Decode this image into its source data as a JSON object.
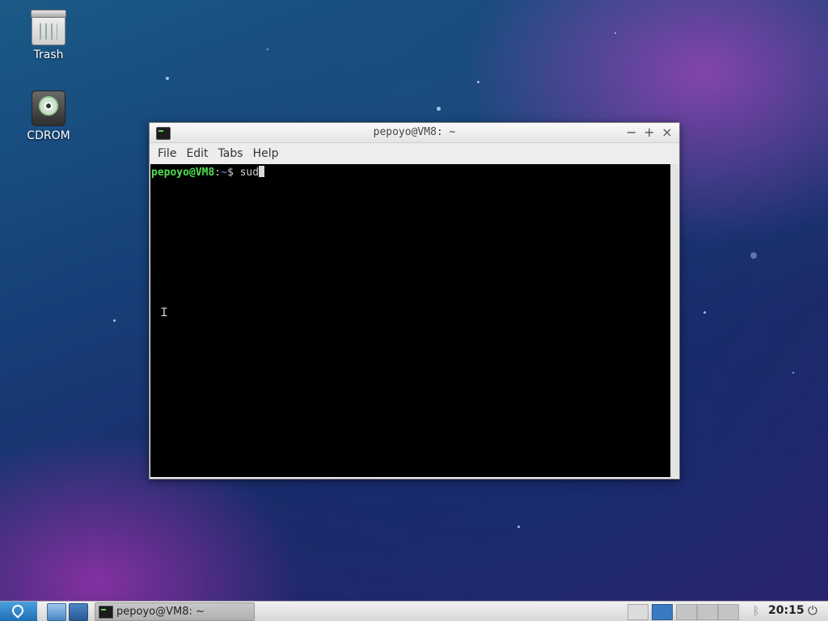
{
  "desktop": {
    "icons": [
      {
        "label": "Trash"
      },
      {
        "label": "CDROM"
      }
    ]
  },
  "window": {
    "title": "pepoyo@VM8: ~",
    "controls": {
      "minimize": "−",
      "maximize": "+",
      "close": "×"
    },
    "menu": [
      "File",
      "Edit",
      "Tabs",
      "Help"
    ],
    "terminal": {
      "user_host": "pepoyo@VM8",
      "colon": ":",
      "path": "~",
      "symbol": "$",
      "command": "sud"
    }
  },
  "taskbar": {
    "task_label": "pepoyo@VM8: ~",
    "clock": "20:15",
    "power_glyph": "⏻",
    "bluetooth_glyph": "ᛒ"
  },
  "colors": {
    "prompt_user": "#4fe04f",
    "prompt_path": "#6d9cf0",
    "terminal_bg": "#000000"
  }
}
